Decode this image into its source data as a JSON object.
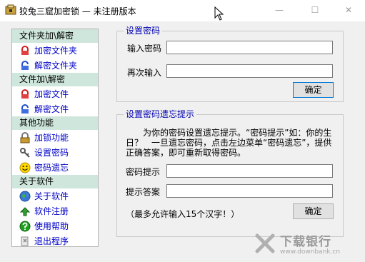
{
  "window": {
    "title": "狡兔三窟加密锁 — 未注册版本",
    "minimize_glyph": "—",
    "maximize_glyph": "☐",
    "close_glyph": "✕"
  },
  "sidebar": {
    "sections": [
      {
        "header": "文件夹加\\解密",
        "items": [
          {
            "label": "加密文件夹",
            "icon": "lock-red-icon"
          },
          {
            "label": "解密文件夹",
            "icon": "unlock-blue-icon"
          }
        ]
      },
      {
        "header": "文件加\\解密",
        "items": [
          {
            "label": "加密文件",
            "icon": "lock-red-icon"
          },
          {
            "label": "解密文件",
            "icon": "unlock-blue-icon"
          }
        ]
      },
      {
        "header": "其他功能",
        "items": [
          {
            "label": "加锁功能",
            "icon": "padlock-icon"
          },
          {
            "label": "设置密码",
            "icon": "keys-icon"
          },
          {
            "label": "密码遗忘",
            "icon": "smiley-icon"
          }
        ]
      },
      {
        "header": "关于软件",
        "items": [
          {
            "label": "关于软件",
            "icon": "globe-icon"
          },
          {
            "label": "软件注册",
            "icon": "green-arrow-icon"
          },
          {
            "label": "使用帮助",
            "icon": "help-icon"
          },
          {
            "label": "退出程序",
            "icon": "exit-icon"
          }
        ]
      }
    ]
  },
  "set_password": {
    "title": "设置密码",
    "password_label": "输入密码",
    "password_value": "",
    "confirm_label": "再次输入",
    "confirm_value": "",
    "ok_label": "确定"
  },
  "hint": {
    "title": "设置密码遗忘提示",
    "description": "为你的密码设置遗忘提示。“密码提示”如：你的生日？　一旦遗忘密码，点击左边菜单“密码遗忘”，提供正确答案，即可重新取得密码。",
    "hint_label": "密码提示",
    "hint_value": "",
    "answer_label": "提示答案",
    "answer_value": "",
    "note": "（最多允许输入15个汉字！）",
    "ok_label": "确定"
  },
  "watermark": {
    "name": "下载银行",
    "url": "www.downbank.cn"
  },
  "colors": {
    "sidebar_header_bg": "#cfe6dc",
    "link_blue": "#0000c8",
    "group_title_blue": "#0000b4"
  }
}
